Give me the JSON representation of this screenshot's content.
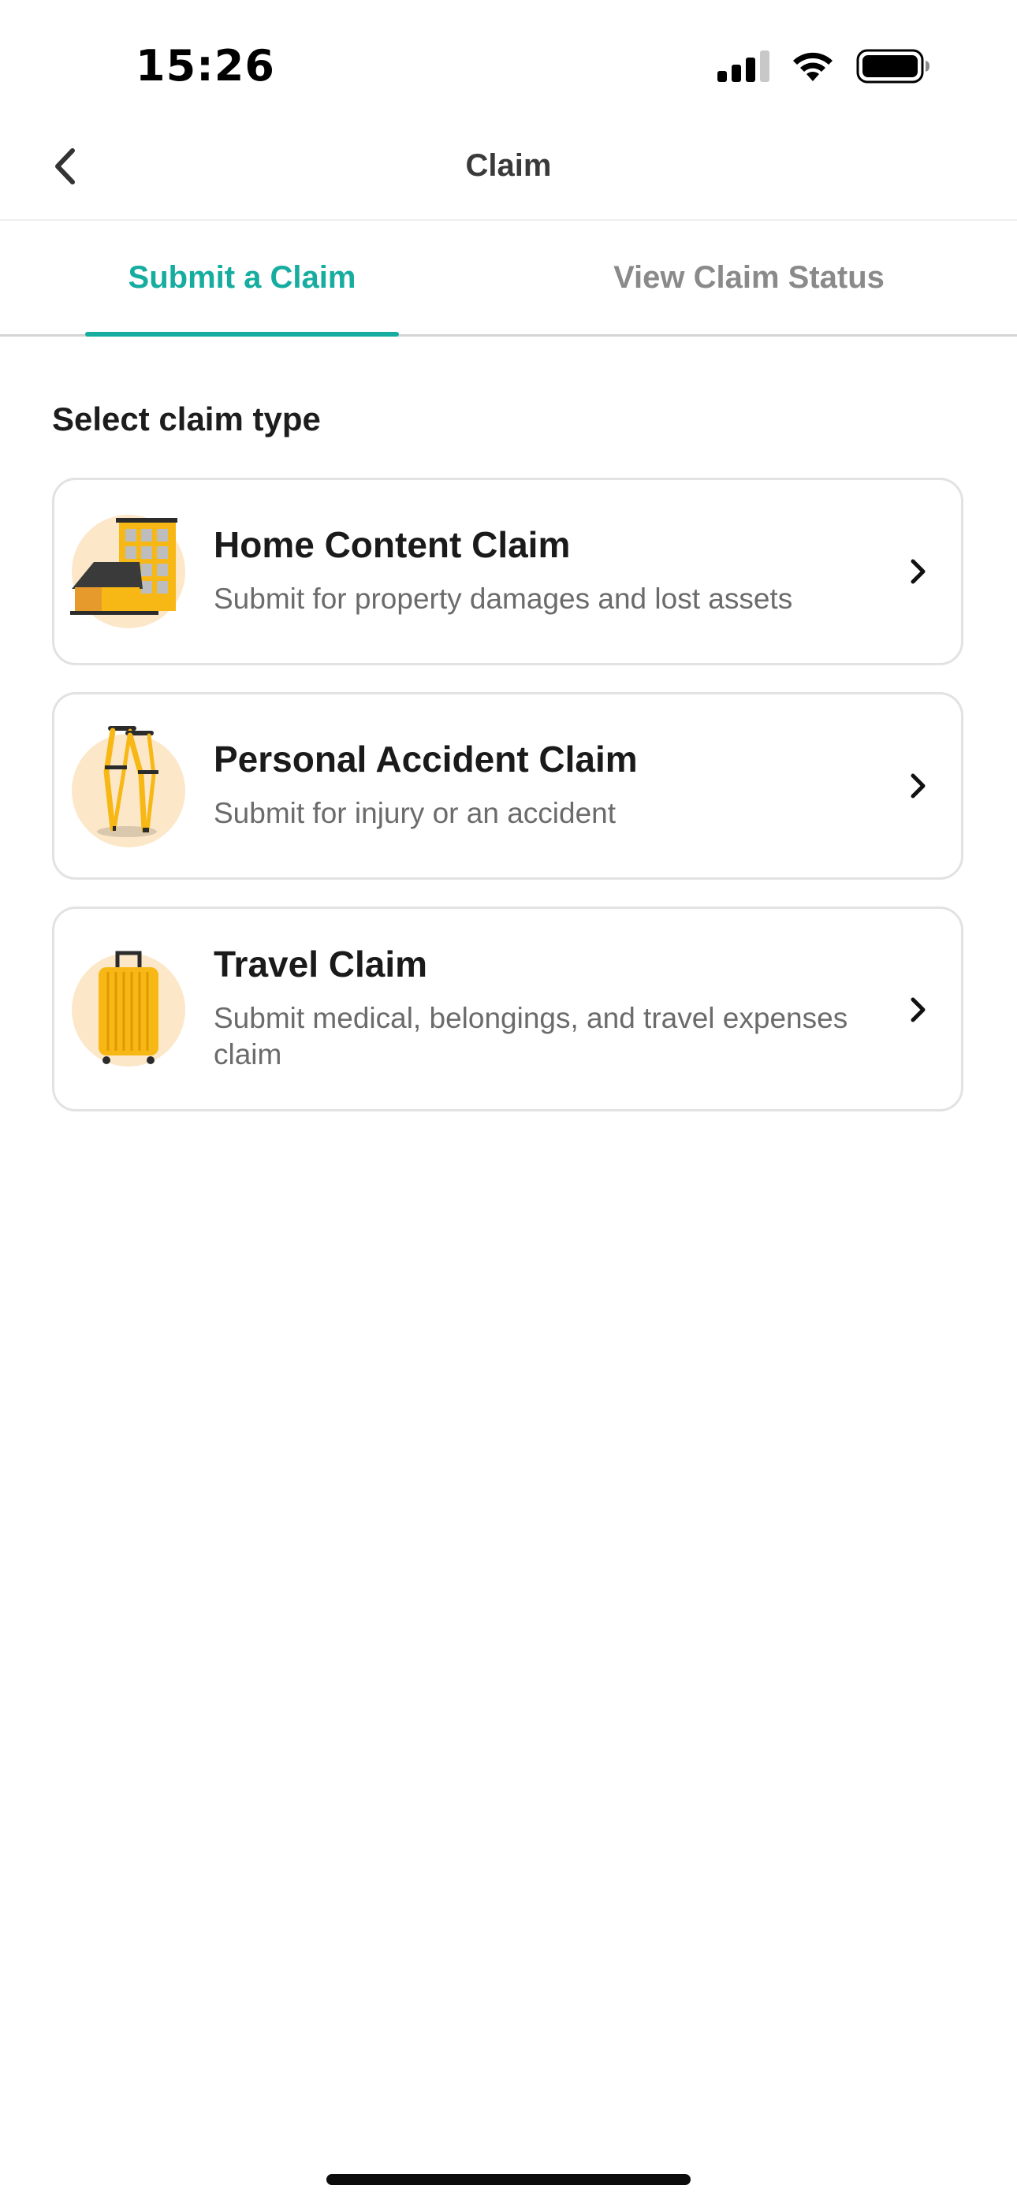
{
  "status_bar": {
    "time": "15:26",
    "icons": [
      "signal-icon",
      "wifi-icon",
      "battery-icon"
    ]
  },
  "nav": {
    "title": "Claim",
    "back_icon": "chevron-left-icon"
  },
  "tabs": [
    {
      "label": "Submit a Claim",
      "active": true
    },
    {
      "label": "View Claim Status",
      "active": false
    }
  ],
  "section": {
    "heading": "Select claim type"
  },
  "claim_types": [
    {
      "title": "Home Content Claim",
      "description": "Submit for property damages and lost assets",
      "icon": "house-building-illustration"
    },
    {
      "title": "Personal Accident Claim",
      "description": "Submit for injury or an accident",
      "icon": "crutches-illustration"
    },
    {
      "title": "Travel Claim",
      "description": "Submit medical, belongings, and travel expenses claim",
      "icon": "suitcase-illustration"
    }
  ],
  "colors": {
    "accent": "#16ada0",
    "illustration_bg": "#fce7c9",
    "illustration_yellow": "#f7b815",
    "card_border": "#e2e2e2",
    "muted_text": "#6b6b6b"
  }
}
